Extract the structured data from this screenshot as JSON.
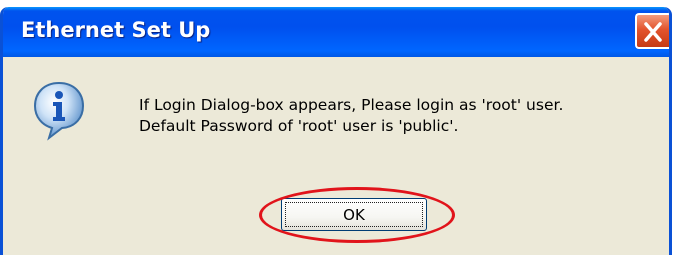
{
  "dialog": {
    "title": "Ethernet Set Up",
    "icon": "information-icon",
    "message_line_1": "If Login Dialog-box appears, Please login as 'root' user.",
    "message_line_2": "Default Password of 'root' user is 'public'.",
    "ok_label": "OK",
    "close_icon": "close-icon"
  },
  "annotation": {
    "highlight": "ok-button",
    "color": "#e1141b"
  },
  "colors": {
    "titlebar": "#0053ee",
    "dialog_background": "#ece9d8",
    "close_button": "#e3542d"
  }
}
